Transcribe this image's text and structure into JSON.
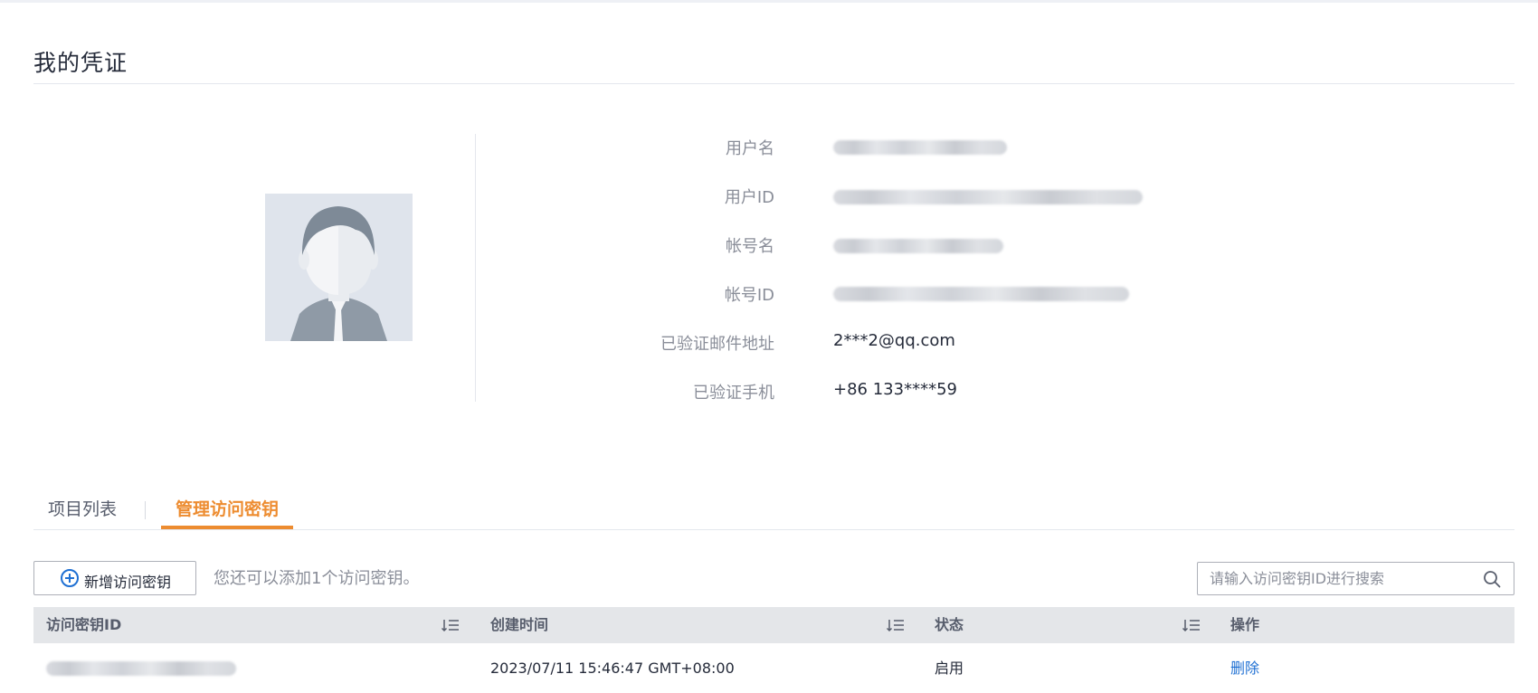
{
  "page": {
    "title": "我的凭证"
  },
  "profile": {
    "avatar_icon": "user-avatar-icon",
    "fields": [
      {
        "label": "用户名",
        "value": "2*************m",
        "masked": true
      },
      {
        "label": "用户ID",
        "value": "cd57063452ba4777ba1ad9dc00c38080",
        "masked": true
      },
      {
        "label": "帐号名",
        "value": "2*************m",
        "masked": true
      },
      {
        "label": "帐号ID",
        "value": "af41f-09097f49-c9-1334-lf8-6367b",
        "masked": true
      },
      {
        "label": "已验证邮件地址",
        "value": "2***2@qq.com",
        "masked": false
      },
      {
        "label": "已验证手机",
        "value": "+86 133****59",
        "masked": false
      }
    ]
  },
  "tabs": [
    {
      "label": "项目列表",
      "active": false
    },
    {
      "label": "管理访问密钥",
      "active": true
    }
  ],
  "toolbar": {
    "add_button_label": "新增访问密钥",
    "hint": "您还可以添加1个访问密钥。",
    "search_placeholder": "请输入访问密钥ID进行搜索"
  },
  "table": {
    "columns": [
      {
        "label": "访问密钥ID",
        "sortable": true
      },
      {
        "label": "创建时间",
        "sortable": true
      },
      {
        "label": "状态",
        "sortable": true
      },
      {
        "label": "操作",
        "sortable": false
      }
    ],
    "rows": [
      {
        "key_id": "************************",
        "created": "2023/07/11 15:46:47 GMT+08:00",
        "status": "启用",
        "action": "删除"
      }
    ]
  },
  "colors": {
    "accent": "#ed8c30",
    "link": "#1f70d3",
    "header_bg": "#e4e6e9"
  }
}
